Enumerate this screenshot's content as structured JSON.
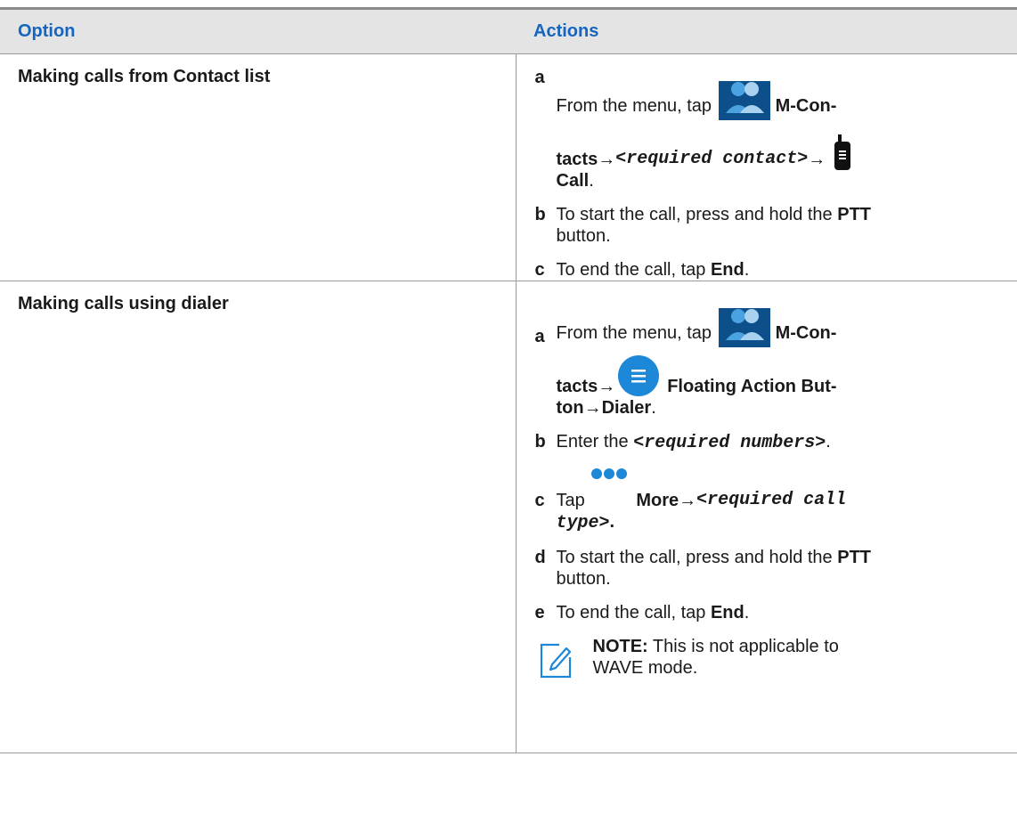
{
  "table": {
    "header": {
      "option": "Option",
      "actions": "Actions"
    },
    "rows": [
      {
        "option": "Making calls from Contact list",
        "steps": [
          {
            "letter": "a",
            "text_1": "From the menu, tap ",
            "icon_1": "contacts-icon",
            "bold_1": "M-Con-",
            "bold_2": "tacts",
            "arrow_1": "→",
            "mono_1": "<required contact>",
            "arrow_2": "→",
            "icon_2": "radio-handset-icon",
            "bold_3": "Call",
            "end": "."
          },
          {
            "letter": "b",
            "text_1": "To start the call, press and hold the ",
            "bold_1": "PTT",
            "text_2": " button."
          },
          {
            "letter": "c",
            "text_1": "To end the call, tap ",
            "bold_1": "End",
            "end": "."
          }
        ]
      },
      {
        "option": "Making calls using dialer",
        "steps": [
          {
            "letter": "a",
            "text_1": "From the menu, tap ",
            "icon_1": "contacts-icon",
            "bold_1": "M-Con-",
            "bold_2": "tacts",
            "arrow_1": "→",
            "icon_2": "floating-action-button-icon",
            "bold_3": "Floating Action But-",
            "bold_4": "ton",
            "arrow_2": "→",
            "bold_5": "Dialer",
            "end": "."
          },
          {
            "letter": "b",
            "text_1": "Enter the ",
            "mono_1": "<required numbers>",
            "end": "."
          },
          {
            "letter": "c",
            "text_1": "Tap ",
            "icon_1": "more-dots-icon",
            "bold_1": "More",
            "arrow_1": "→",
            "mono_1": "<required call",
            "mono_2": "type>",
            "end": "."
          },
          {
            "letter": "d",
            "text_1": "To start the call, press and hold the ",
            "bold_1": "PTT",
            "text_2": " button."
          },
          {
            "letter": "e",
            "text_1": "To end the call, tap ",
            "bold_1": "End",
            "end": "."
          }
        ],
        "note": {
          "icon": "note-pencil-icon",
          "label": "NOTE:",
          "text_1": " This is not applicable to",
          "text_2": "WAVE mode."
        }
      }
    ]
  },
  "colors": {
    "header_text": "#1565c0",
    "header_bg": "#e4e4e4",
    "icon_blue": "#1e88d8",
    "icon_dark_blue": "#0d4f8b"
  }
}
